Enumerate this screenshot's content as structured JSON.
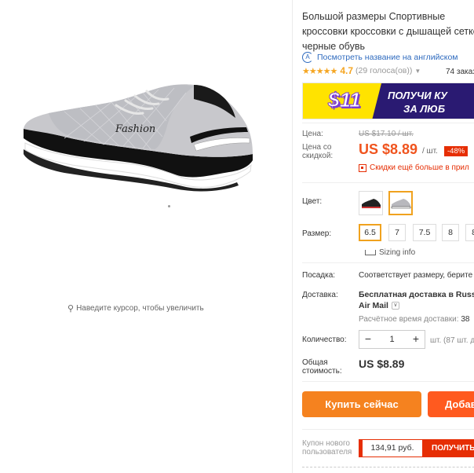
{
  "gallery": {
    "zoom_hint": "Наведите курсор, чтобы увеличить",
    "shoe_logo_text": "Fashion"
  },
  "product": {
    "title": "Большой размеры Спортивные кроссовки кроссовки с дышащей сеткой черные обувь",
    "translate_link": "Посмотреть название на английском",
    "rating": {
      "value": "4.7",
      "stars_out_of_5": 4.7,
      "votes": "(29 голоса(ов))",
      "orders": "74 заказ"
    },
    "banner": {
      "price": "$11",
      "line1": "ПОЛУЧИ КУ",
      "line2": "ЗА ЛЮБ"
    },
    "pricing": {
      "price_label": "Цена:",
      "old_price": "US $17.10 / шт.",
      "discount_label": "Цена со скидкой:",
      "new_price": "US $8.89",
      "unit": "/ шт.",
      "discount_badge": "-48%",
      "more_discounts": "Скидки ещё больше в прил"
    },
    "color": {
      "label": "Цвет:",
      "options": [
        "black-shoe",
        "grey-shoe"
      ],
      "selected_index": 1
    },
    "size": {
      "label": "Размер:",
      "options": [
        "6.5",
        "7",
        "7.5",
        "8",
        "8"
      ],
      "selected": "6.5",
      "sizing_info": "Sizing info"
    },
    "fit": {
      "label": "Посадка:",
      "value": "Соответствует размеру, берите"
    },
    "shipping": {
      "label": "Доставка:",
      "value_line1": "Бесплатная доставка в Russi",
      "value_line2": "Air Mail",
      "time_label": "Расчётное время доставки:",
      "time_value": "38"
    },
    "quantity": {
      "label": "Количество:",
      "minus": "−",
      "value": "1",
      "plus": "+",
      "unit_info": "шт. (87 шт. д"
    },
    "total": {
      "label": "Общая стоимость:",
      "value": "US $8.89"
    },
    "buttons": {
      "buy_now": "Купить сейчас",
      "add_to_cart": "Добав"
    },
    "coupon": {
      "label": "Купон нового пользователя",
      "value": "134,91 руб.",
      "action": "ПОЛУЧИТЬ"
    }
  },
  "colors": {
    "accent_orange": "#f5821f",
    "price_red": "#f0541e",
    "badge_red": "#e62e04",
    "link_blue": "#2f6bbf",
    "star_gold": "#f5a623",
    "banner_navy": "#2a1a72",
    "banner_yellow": "#ffe300"
  }
}
